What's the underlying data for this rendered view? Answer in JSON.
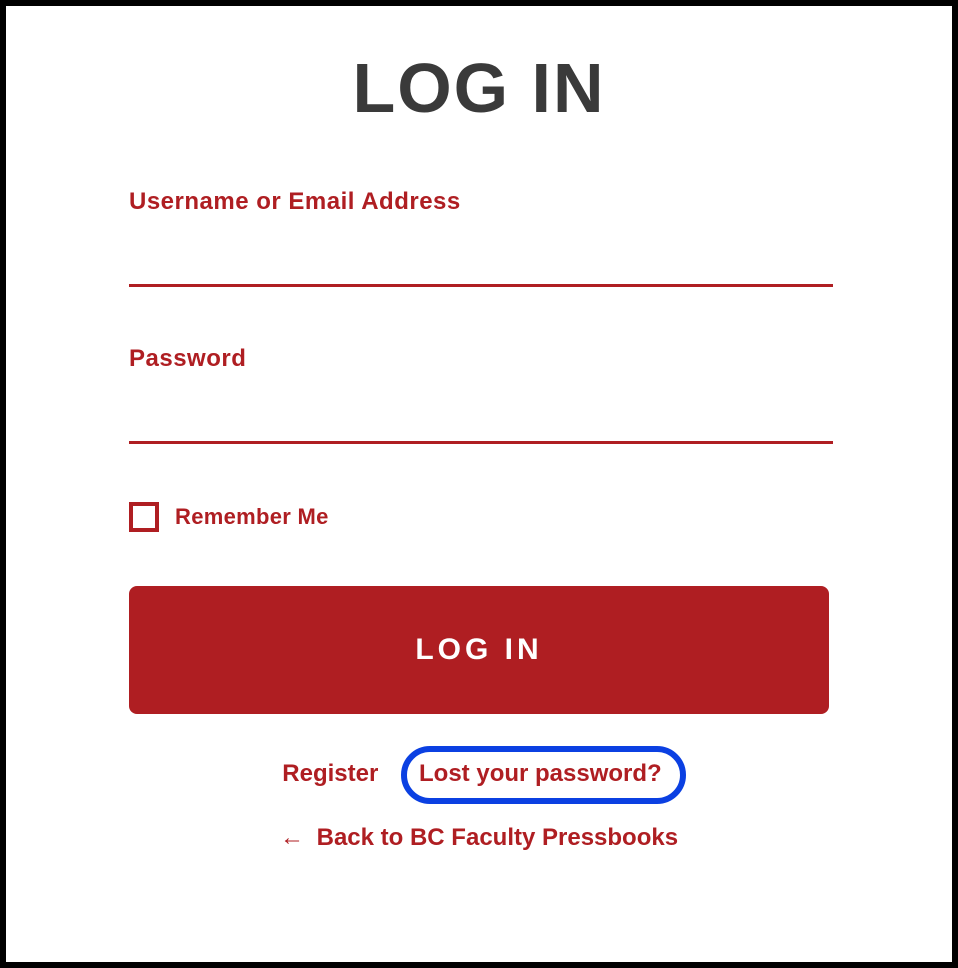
{
  "title": "LOG IN",
  "fields": {
    "username_label": "Username or Email Address",
    "username_value": "",
    "password_label": "Password",
    "password_value": ""
  },
  "remember": {
    "label": "Remember Me",
    "checked": false
  },
  "button_label": "LOG IN",
  "links": {
    "register": "Register",
    "lost_password": "Lost your password?",
    "back_arrow": "←",
    "back_label": "Back to BC Faculty Pressbooks"
  },
  "highlight": {
    "target": "lost-password-link",
    "color": "#0b40e2"
  },
  "colors": {
    "accent": "#af1e22",
    "title": "#3a3a3a"
  }
}
